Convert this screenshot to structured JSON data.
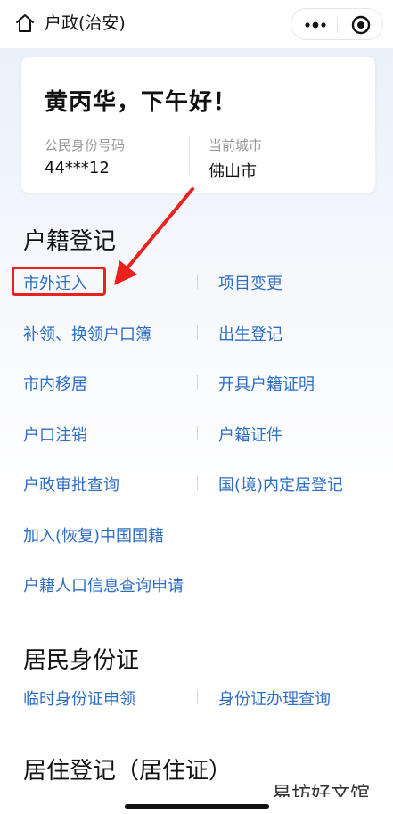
{
  "navbar": {
    "title": "户政(治安)",
    "home_icon": "home-icon",
    "more_icon": "more-dots-icon",
    "close_icon": "close-miniprogram-icon"
  },
  "user_card": {
    "greeting": "黄丙华，下午好！",
    "id_label": "公民身份号码",
    "id_value": "44***12",
    "city_label": "当前城市",
    "city_value": "佛山市"
  },
  "sections": [
    {
      "title": "户籍登记",
      "items": [
        "市外迁入",
        "项目变更",
        "补领、换领户口簿",
        "出生登记",
        "市内移居",
        "开具户籍证明",
        "户口注销",
        "户籍证件",
        "户政审批查询",
        "国(境)内定居登记",
        "加入(恢复)中国国籍",
        "户籍人口信息查询申请"
      ]
    },
    {
      "title": "居民身份证",
      "items": [
        "临时身份证申领",
        "身份证办理查询"
      ]
    },
    {
      "title": "居住登记（居住证）",
      "items": []
    }
  ],
  "annotation": {
    "highlight_color": "#e8231e"
  },
  "colors": {
    "link": "#2e6ec6",
    "accent_red": "#e8231e"
  },
  "watermark": "易坊好文馆"
}
